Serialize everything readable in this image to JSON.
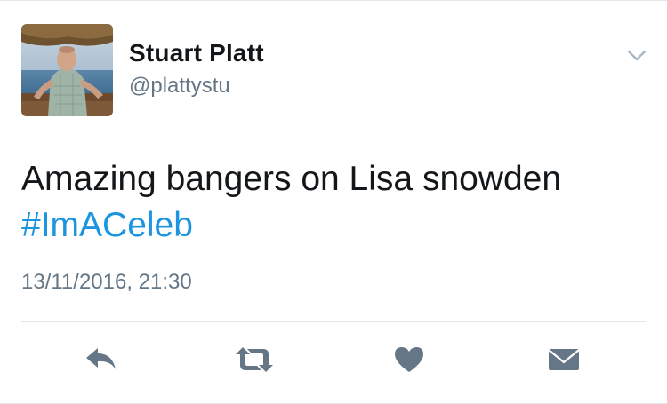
{
  "tweet": {
    "author": {
      "name": "Stuart Platt",
      "handle": "@plattystu"
    },
    "text": "Amazing bangers on Lisa snowden",
    "hashtag": "#ImACeleb",
    "timestamp": "13/11/2016, 21:30"
  },
  "actions": [
    "reply-icon",
    "retweet-icon",
    "like-icon",
    "direct-message-icon"
  ],
  "colors": {
    "text": "#14171a",
    "secondary": "#657786",
    "link": "#1b95e0",
    "icon": "#657786",
    "divider": "#e1e8ed"
  }
}
